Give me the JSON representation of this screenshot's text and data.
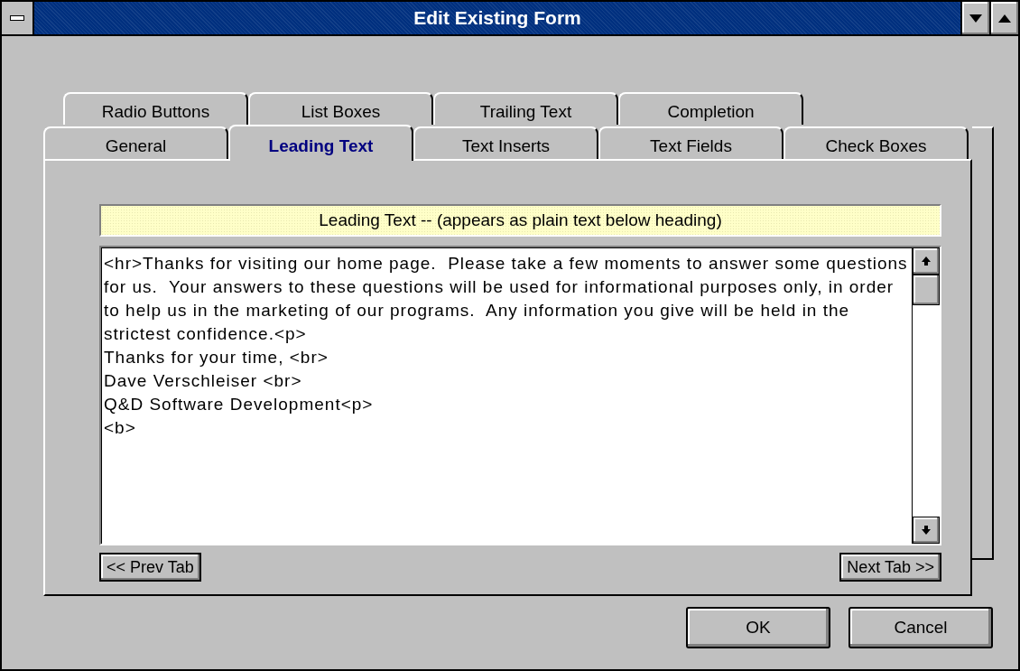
{
  "window": {
    "title": "Edit Existing Form"
  },
  "tab_rows": [
    [
      {
        "label": "Radio Buttons",
        "selected": false
      },
      {
        "label": "List Boxes",
        "selected": false
      },
      {
        "label": "Trailing Text",
        "selected": false
      },
      {
        "label": "Completion",
        "selected": false
      }
    ],
    [
      {
        "label": "General",
        "selected": false
      },
      {
        "label": "Leading Text",
        "selected": true
      },
      {
        "label": "Text Inserts",
        "selected": false
      },
      {
        "label": "Text Fields",
        "selected": false
      },
      {
        "label": "Check Boxes",
        "selected": false
      }
    ]
  ],
  "panel": {
    "heading": "Leading Text -- (appears as plain text below heading)",
    "text": "<hr>Thanks for visiting our home page.  Please take a few moments to answer some questions for us.  Your answers to these questions will be used for informational purposes only, in order to help us in the marketing of our programs.  Any information you give will be held in the strictest confidence.<p>\nThanks for your time, <br>\nDave Verschleiser <br>\nQ&D Software Development<p>\n<b>",
    "prev_button": "<< Prev Tab",
    "next_button": "Next Tab >>"
  },
  "buttons": [
    "OK",
    "Cancel"
  ]
}
